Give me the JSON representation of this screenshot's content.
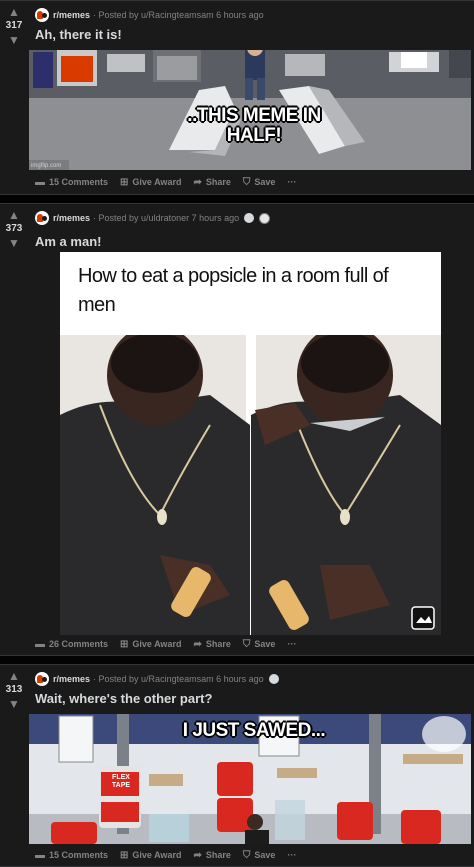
{
  "posts": [
    {
      "score": "317",
      "subreddit": "r/memes",
      "posted_by": "· Posted by u/Racingteamsam 6 hours ago",
      "title": "Ah, there it is!",
      "caption": "..THIS MEME IN HALF!",
      "watermark": "imgflip.com",
      "comments": "15 Comments",
      "award": "Give Award",
      "share": "Share",
      "save": "Save",
      "more": "···"
    },
    {
      "score": "373",
      "subreddit": "r/memes",
      "posted_by": "· Posted by u/uldratoner 7 hours ago",
      "title": "Am a man!",
      "image_text": "How to eat a popsicle in a room full of men",
      "comments": "26 Comments",
      "award": "Give Award",
      "share": "Share",
      "save": "Save",
      "more": "···"
    },
    {
      "score": "313",
      "subreddit": "r/memes",
      "posted_by": "· Posted by u/Racingteamsam 6 hours ago",
      "title": "Wait, where's the other part?",
      "caption": "I JUST SAWED...",
      "brand_text": "FLEX TAPE",
      "comments": "15 Comments",
      "award": "Give Award",
      "share": "Share",
      "save": "Save",
      "more": "···"
    }
  ],
  "icons": {
    "upvote": "▲",
    "downvote": "▼",
    "comment": "comment-icon",
    "gift": "gift-icon",
    "share": "share-icon",
    "save": "bookmark-icon"
  },
  "colors": {
    "background": "#030303",
    "card": "#1a1a1b",
    "text": "#d7dadc",
    "muted": "#818384",
    "brand_red": "#d93a00"
  }
}
